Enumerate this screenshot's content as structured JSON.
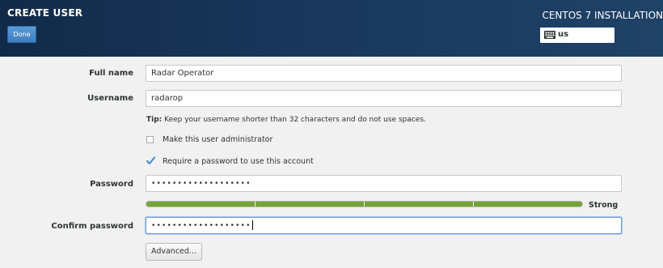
{
  "header": {
    "title": "CREATE USER",
    "done_label": "Done",
    "product_title": "CENTOS 7 INSTALLATION",
    "keyboard_layout": "us"
  },
  "form": {
    "full_name": {
      "label": "Full name",
      "value": "Radar Operator"
    },
    "username": {
      "label": "Username",
      "value": "radarop"
    },
    "tip": {
      "prefix": "Tip:",
      "text": " Keep your username shorter than 32 characters and do not use spaces."
    },
    "admin_checkbox": {
      "label": "Make this user administrator",
      "checked": false
    },
    "require_password_checkbox": {
      "label": "Require a password to use this account",
      "checked": true
    },
    "password": {
      "label": "Password",
      "masked_value": "•••••••••••••••••••"
    },
    "strength": {
      "label": "Strong",
      "level": 1.0,
      "color": "#73a534"
    },
    "confirm_password": {
      "label": "Confirm password",
      "masked_value": "•••••••••••••••••••"
    },
    "advanced_label": "Advanced..."
  },
  "colors": {
    "header_bg": "#19375c",
    "accent": "#3f7fbf",
    "page_bg": "#f1f1f1"
  }
}
